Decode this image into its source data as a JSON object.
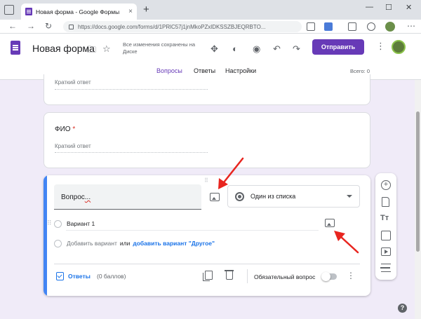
{
  "browser": {
    "tab_title": "Новая форма - Google Формы",
    "tab_close": "×",
    "new_tab": "+",
    "url": "https://docs.google.com/forms/d/1PRlC57j1jnMkoPZxlDKSSZBJEQRBTO...",
    "nav": {
      "back": "←",
      "forward": "→",
      "reload": "↻"
    },
    "window_controls": {
      "minimize": "—",
      "maximize": "☐",
      "close": "✕"
    }
  },
  "header": {
    "form_name": "Новая форма",
    "save_status": "Все изменения сохранены на Диске",
    "send_button": "Отправить",
    "more": "⋮",
    "icons": {
      "folder": "🗀",
      "star": "☆",
      "addons": "✥",
      "palette": "◐",
      "preview": "◉",
      "undo": "↶",
      "redo": "↷"
    }
  },
  "tabs": {
    "items": [
      {
        "label": "Вопросы",
        "active": true
      },
      {
        "label": "Ответы",
        "active": false
      },
      {
        "label": "Настройки",
        "active": false
      }
    ],
    "total_score": "Всего: 0"
  },
  "cards": {
    "prev_short_answer": "Краткий ответ",
    "fio_title": "ФИО",
    "fio_required": " *",
    "fio_short_answer": "Краткий ответ"
  },
  "active_question": {
    "drag": "⠿",
    "title_value": "Вопрос",
    "title_suffix": "...",
    "type_label": "Один из списка",
    "option_drag": "⠿",
    "option1": "Вариант 1",
    "add_option": "Добавить вариант",
    "or": "или",
    "add_other": "добавить вариант \"Другое\"",
    "answers_link": "Ответы",
    "points": "(0 баллов)",
    "required_label": "Обязательный вопрос",
    "more": "⋮"
  },
  "side_toolbar": {
    "add": "+",
    "title": "Tт"
  },
  "help": "?",
  "colors": {
    "brand": "#673ab7",
    "background": "#f0ebf8",
    "focus_bar": "#4285f4",
    "link": "#1a73e8",
    "annotation_arrow": "#e8251f"
  }
}
